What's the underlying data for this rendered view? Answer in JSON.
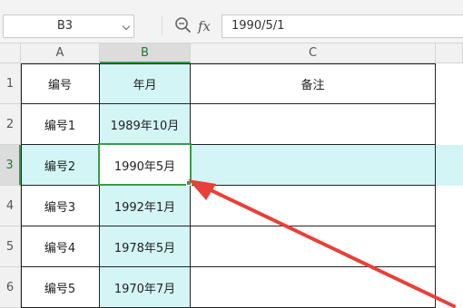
{
  "formula_bar": {
    "name_box": "B3",
    "formula": "1990/5/1",
    "zoom_icon": "zoom-icon",
    "fx_label": "fx"
  },
  "columns": [
    "A",
    "B",
    "C"
  ],
  "rows": [
    {
      "num": "1",
      "a": "编号",
      "b": "年月",
      "c": "备注"
    },
    {
      "num": "2",
      "a": "编号1",
      "b": "1989年10月",
      "c": ""
    },
    {
      "num": "3",
      "a": "编号2",
      "b": "1990年5月",
      "c": ""
    },
    {
      "num": "4",
      "a": "编号3",
      "b": "1992年1月",
      "c": ""
    },
    {
      "num": "5",
      "a": "编号4",
      "b": "1978年5月",
      "c": ""
    },
    {
      "num": "6",
      "a": "编号5",
      "b": "1970年7月",
      "c": ""
    }
  ],
  "selected_cell": "B3",
  "colors": {
    "highlight_fill": "#d3f5f5",
    "selection_border": "#3a9a4b",
    "annotation_arrow": "#e8403a"
  }
}
